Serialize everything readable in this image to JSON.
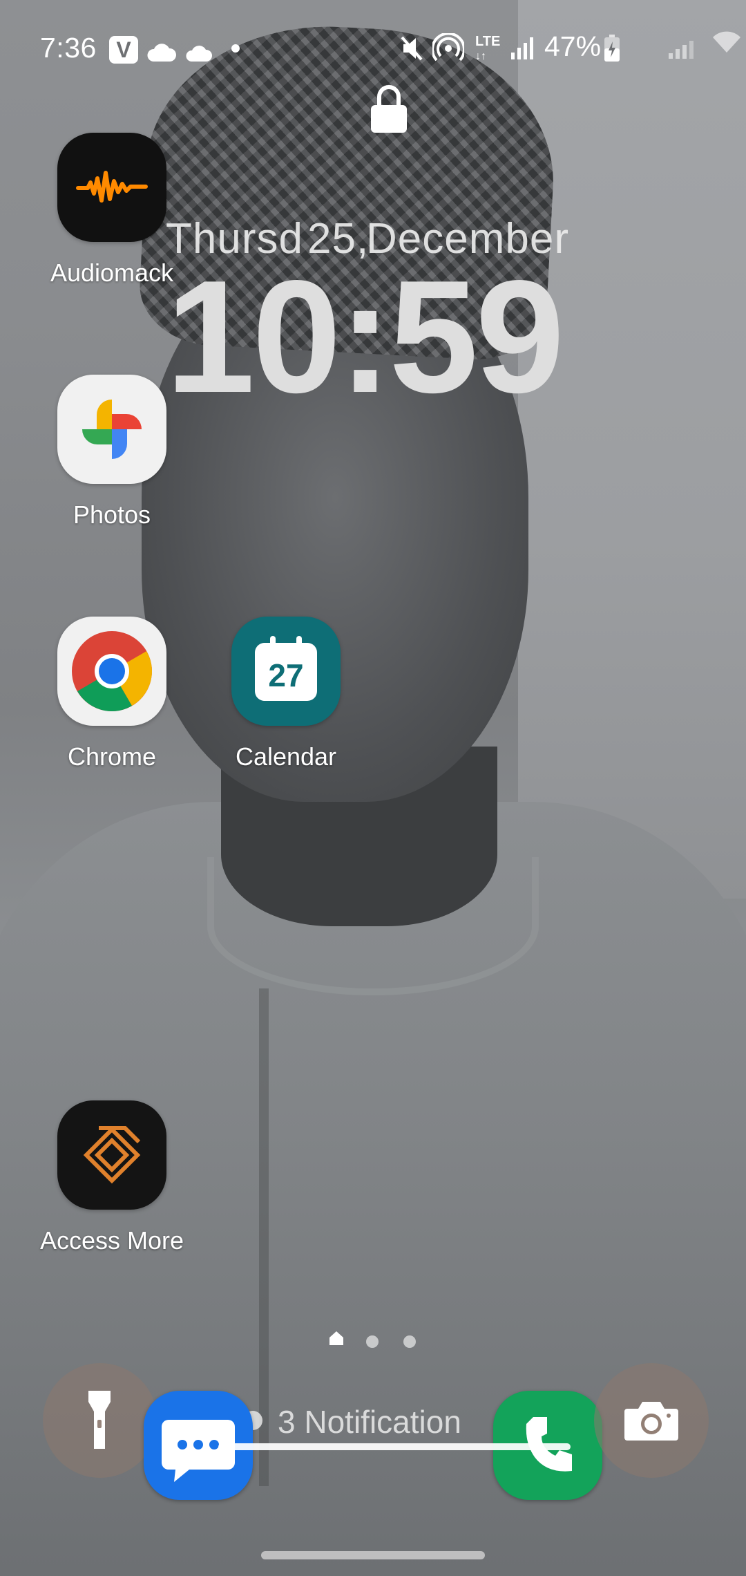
{
  "status_bar": {
    "time": "7:36",
    "app_badge": "V",
    "network_type": "LTE",
    "battery_percent": "47%"
  },
  "lock_screen": {
    "date_day": "Thursd",
    "date_overlap": "25,",
    "date_month": "December",
    "clock": "10:59"
  },
  "apps": [
    {
      "label": "Audiomack",
      "icon": "audiomack-icon"
    },
    {
      "label": "Photos",
      "icon": "google-photos-icon"
    },
    {
      "label": "Chrome",
      "icon": "chrome-icon"
    },
    {
      "label": "Calendar",
      "icon": "calendar-icon",
      "icon_text": "27"
    },
    {
      "label": "Access More",
      "icon": "access-more-icon"
    }
  ],
  "page_indicator": {
    "pages": 3,
    "current": 0
  },
  "notifications": {
    "text": "3 Notification"
  },
  "colors": {
    "audiomack_bg": "#111111",
    "audiomack_accent": "#ff8a00",
    "calendar_bg": "#0e6e76",
    "messages_bg": "#1a73e8",
    "phone_bg": "#13a35a",
    "access_more_accent": "#e0812c"
  }
}
